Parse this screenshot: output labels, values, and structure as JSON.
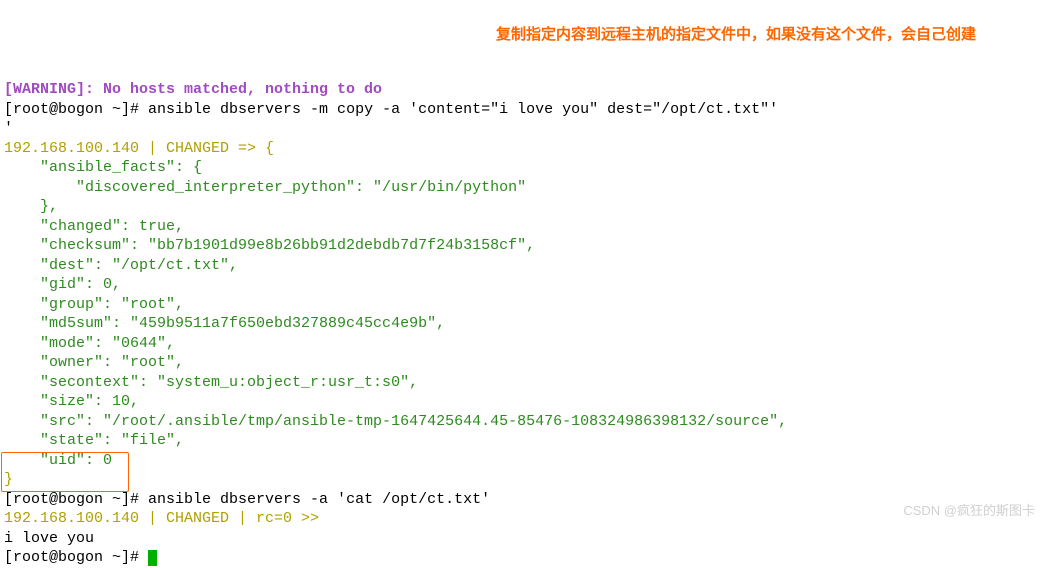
{
  "warning_line": "[WARNING]: No hosts matched, nothing to do",
  "prompt1": "[root@bogon ~]# ",
  "cmd1": "ansible dbservers -m copy -a 'content=\"i love you\" dest=\"/opt/ct.txt\"'",
  "host_header": "192.168.100.140 | CHANGED => {",
  "json_lines": {
    "ansible_facts_open": "    \"ansible_facts\": {",
    "interpreter": "        \"discovered_interpreter_python\": \"/usr/bin/python\"",
    "ansible_facts_close": "    },",
    "changed": "    \"changed\": true,",
    "checksum": "    \"checksum\": \"bb7b1901d99e8b26bb91d2debdb7d7f24b3158cf\",",
    "dest": "    \"dest\": \"/opt/ct.txt\",",
    "gid": "    \"gid\": 0,",
    "group": "    \"group\": \"root\",",
    "md5sum": "    \"md5sum\": \"459b9511a7f650ebd327889c45cc4e9b\",",
    "mode": "    \"mode\": \"0644\",",
    "owner": "    \"owner\": \"root\",",
    "secontext": "    \"secontext\": \"system_u:object_r:usr_t:s0\",",
    "size": "    \"size\": 10,",
    "src": "    \"src\": \"/root/.ansible/tmp/ansible-tmp-1647425644.45-85476-108324986398132/source\",",
    "state": "    \"state\": \"file\",",
    "uid": "    \"uid\": 0",
    "close": "}"
  },
  "prompt2": "[root@bogon ~]# ",
  "cmd2": "ansible dbservers -a 'cat /opt/ct.txt'",
  "host_header2": "192.168.100.140 | CHANGED | rc=0 >>",
  "output2": "i love you",
  "prompt3": "[root@bogon ~]# ",
  "annotation_text": "复制指定内容到远程主机的指定文件中，如果没有这个文件，会自己创建",
  "watermark": "CSDN @疯狂的斯图卡"
}
